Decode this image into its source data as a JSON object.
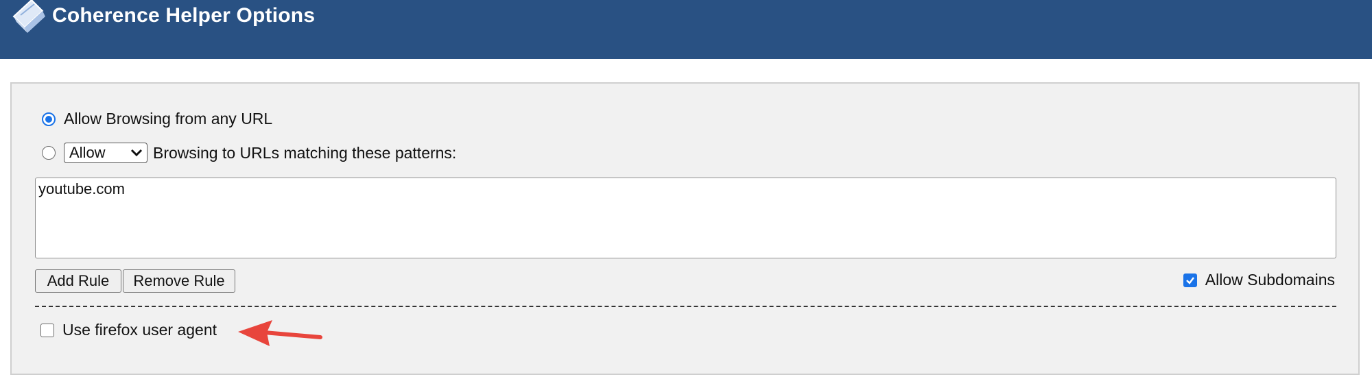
{
  "header": {
    "title": "Coherence Helper Options"
  },
  "browsing": {
    "any_url_label": "Allow Browsing from any URL",
    "any_url_selected": true,
    "patterns_selected": false,
    "mode_select_value": "Allow",
    "patterns_label": "Browsing to URLs matching these patterns:",
    "patterns_text": "youtube.com"
  },
  "buttons": {
    "add_rule": "Add Rule",
    "remove_rule": "Remove Rule"
  },
  "subdomains": {
    "label": "Allow Subdomains",
    "checked": true
  },
  "user_agent": {
    "label": "Use firefox user agent",
    "checked": false
  },
  "colors": {
    "header_bg": "#295183",
    "accent": "#1a73e8",
    "annotation_arrow": "#e8453c"
  }
}
